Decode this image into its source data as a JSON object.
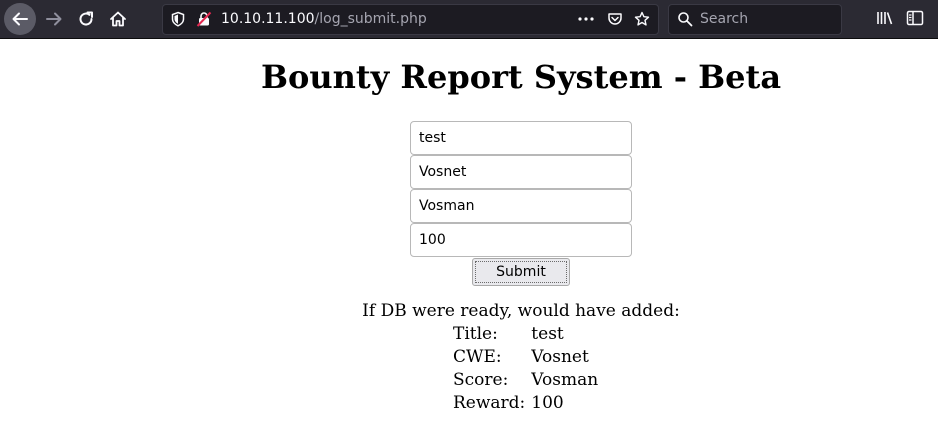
{
  "browser": {
    "url_host": "10.10.11.100",
    "url_path": "/log_submit.php",
    "search_placeholder": "Search",
    "icons": [
      "back-arrow-icon",
      "forward-arrow-icon",
      "reload-icon",
      "home-icon",
      "shield-icon",
      "insecure-lock-icon",
      "more-icon",
      "pocket-icon",
      "star-icon",
      "search-icon",
      "library-icon",
      "sidebar-icon"
    ]
  },
  "page": {
    "title": "Bounty Report System - Beta",
    "form": {
      "title_value": "test",
      "cwe_value": "Vosnet",
      "score_value": "Vosman",
      "reward_value": "100",
      "submit_label": "Submit"
    },
    "result": {
      "intro": "If DB were ready, would have added:",
      "rows": [
        {
          "label": "Title:",
          "value": "test"
        },
        {
          "label": "CWE:",
          "value": "Vosnet"
        },
        {
          "label": "Score:",
          "value": "Vosman"
        },
        {
          "label": "Reward:",
          "value": "100"
        }
      ]
    }
  }
}
